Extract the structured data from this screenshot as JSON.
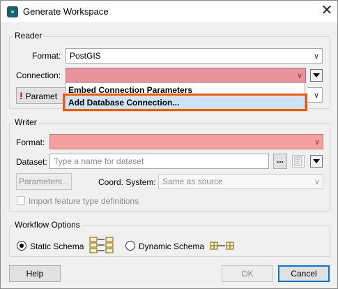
{
  "window": {
    "title": "Generate Workspace"
  },
  "reader": {
    "group_label": "Reader",
    "format_label": "Format:",
    "format_value": "PostGIS",
    "connection_label": "Connection:",
    "connection_value": "",
    "parameters_button": "Parameters...",
    "parameters_visible": "Paramet"
  },
  "connection_dropdown": {
    "items": [
      "Embed Connection Parameters",
      "Add Database Connection..."
    ],
    "selected_index": 1
  },
  "writer": {
    "group_label": "Writer",
    "format_label": "Format:",
    "format_value": "",
    "dataset_label": "Dataset:",
    "dataset_placeholder": "Type a name for dataset",
    "browse_button": "...",
    "parameters_button": "Parameters...",
    "coord_label": "Coord. System:",
    "coord_value": "Same as source",
    "import_checkbox_label": "Import feature type definitions",
    "import_checked": false
  },
  "workflow": {
    "group_label": "Workflow Options",
    "static_label": "Static Schema",
    "dynamic_label": "Dynamic Schema",
    "selected": "static"
  },
  "footer": {
    "help": "Help",
    "ok": "OK",
    "cancel": "Cancel"
  }
}
